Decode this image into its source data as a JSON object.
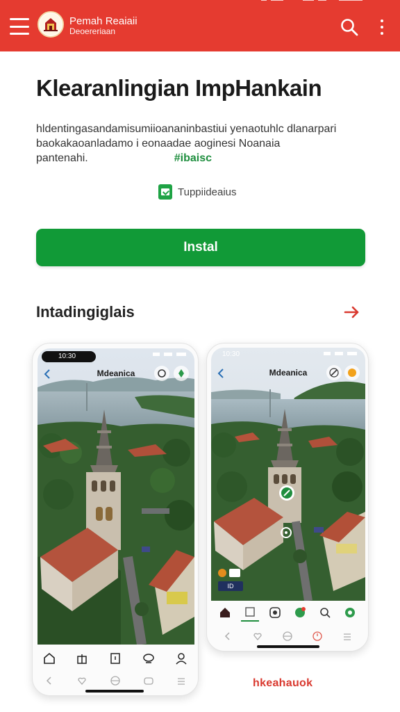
{
  "app_bar": {
    "brand_line1": "Pemah Reaiaii",
    "brand_line2": "Deoereriaan",
    "accent": "#e53b30",
    "icons": [
      "menu-icon",
      "logo-emblem",
      "search-icon",
      "more-vert-icon"
    ]
  },
  "app": {
    "title": "Klearanlingian ImpHankain",
    "description": "hldentingasandamisumiioananinbastiui yenaotuhlc dlanarpari baokakaoanladamo i eonaadae aoginesi Noanaia pantenahi.",
    "tag": "#ibaisc",
    "badge_label": "Tuppiideaius",
    "install_label": "Instal",
    "install_color": "#119a37"
  },
  "screenshots": {
    "section_title": "Intadingiglais",
    "phones": [
      {
        "status_time": "10:30",
        "screen_title": "Mdeanica",
        "nav_icons": [
          "home-icon",
          "gift-icon",
          "bookmark-icon",
          "chat-icon",
          "profile-icon"
        ]
      },
      {
        "status_time": "10:30",
        "screen_title": "Mdeanica",
        "badge_text": "ID",
        "nav_icons": [
          "home-icon",
          "map-icon",
          "save-icon",
          "alert-icon",
          "search-icon",
          "settings-icon"
        ]
      }
    ]
  },
  "footer": {
    "brand_text": "hkeahauok"
  }
}
